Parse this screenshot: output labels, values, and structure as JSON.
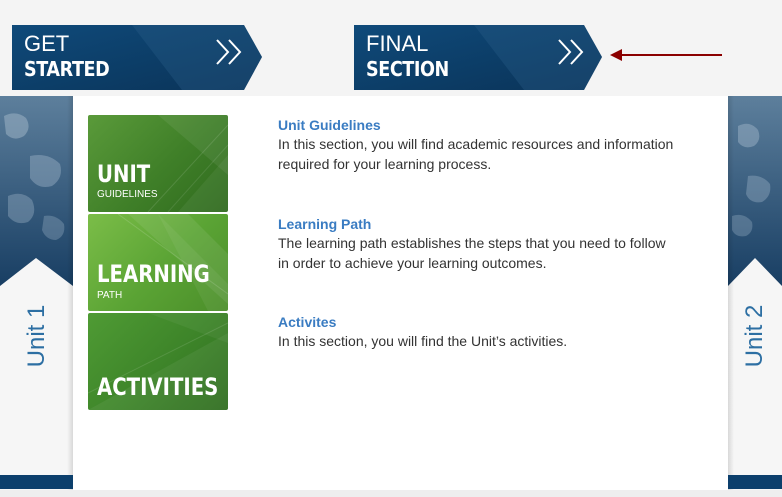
{
  "nav": {
    "get_started": {
      "line1": "GET",
      "line2": "STARTED"
    },
    "final_section": {
      "line1": "FINAL",
      "line2": "SECTION"
    }
  },
  "side": {
    "left_label": "Unit 1",
    "right_label": "Unit 2"
  },
  "tiles": [
    {
      "big": "UNIT",
      "small": "GUIDELINES"
    },
    {
      "big": "LEARNING",
      "small": "PATH"
    },
    {
      "big": "ACTIVITIES",
      "small": ""
    }
  ],
  "items": [
    {
      "title": "Unit Guidelines",
      "desc": "In this section, you will find academic resources and information required for your learning process."
    },
    {
      "title": "Learning Path",
      "desc": "The learning path establishes the steps that you need to follow in order to achieve your learning outcomes."
    },
    {
      "title": "Activites",
      "desc": "In this section, you will find the Unit’s activities."
    }
  ],
  "colors": {
    "banner_dark": "#0c3f6c",
    "link_blue": "#3a7cc2",
    "annotation_red": "#8b0000",
    "tile_green": "#4e9a2e"
  },
  "icons": [
    "chevron-double-right-icon",
    "arrow-left-icon",
    "world-map-texture"
  ]
}
